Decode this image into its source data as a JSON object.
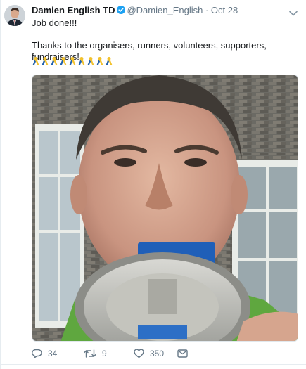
{
  "author": {
    "display_name": "Damien English TD",
    "handle": "@Damien_English",
    "separator": "·",
    "time": "Oct 28"
  },
  "tweet": {
    "line1": "Job done!!!",
    "line2": "Thanks to the organisers, runners, volunteers, supporters, fundraisers!",
    "ribbon_emoji_count": 9
  },
  "stats": {
    "replies": "34",
    "retweets": "9",
    "likes": "350"
  },
  "colors": {
    "verified": "#1da1f2",
    "muted": "#657786",
    "text": "#14171a",
    "border": "#e6ecf0",
    "ribbon": "#f2c22e",
    "ribbon_accent": "#1b5fb4"
  },
  "icons": [
    "verified-badge-icon",
    "chevron-down-icon",
    "awareness-ribbon-icon",
    "reply-icon",
    "retweet-icon",
    "like-icon",
    "message-icon"
  ]
}
